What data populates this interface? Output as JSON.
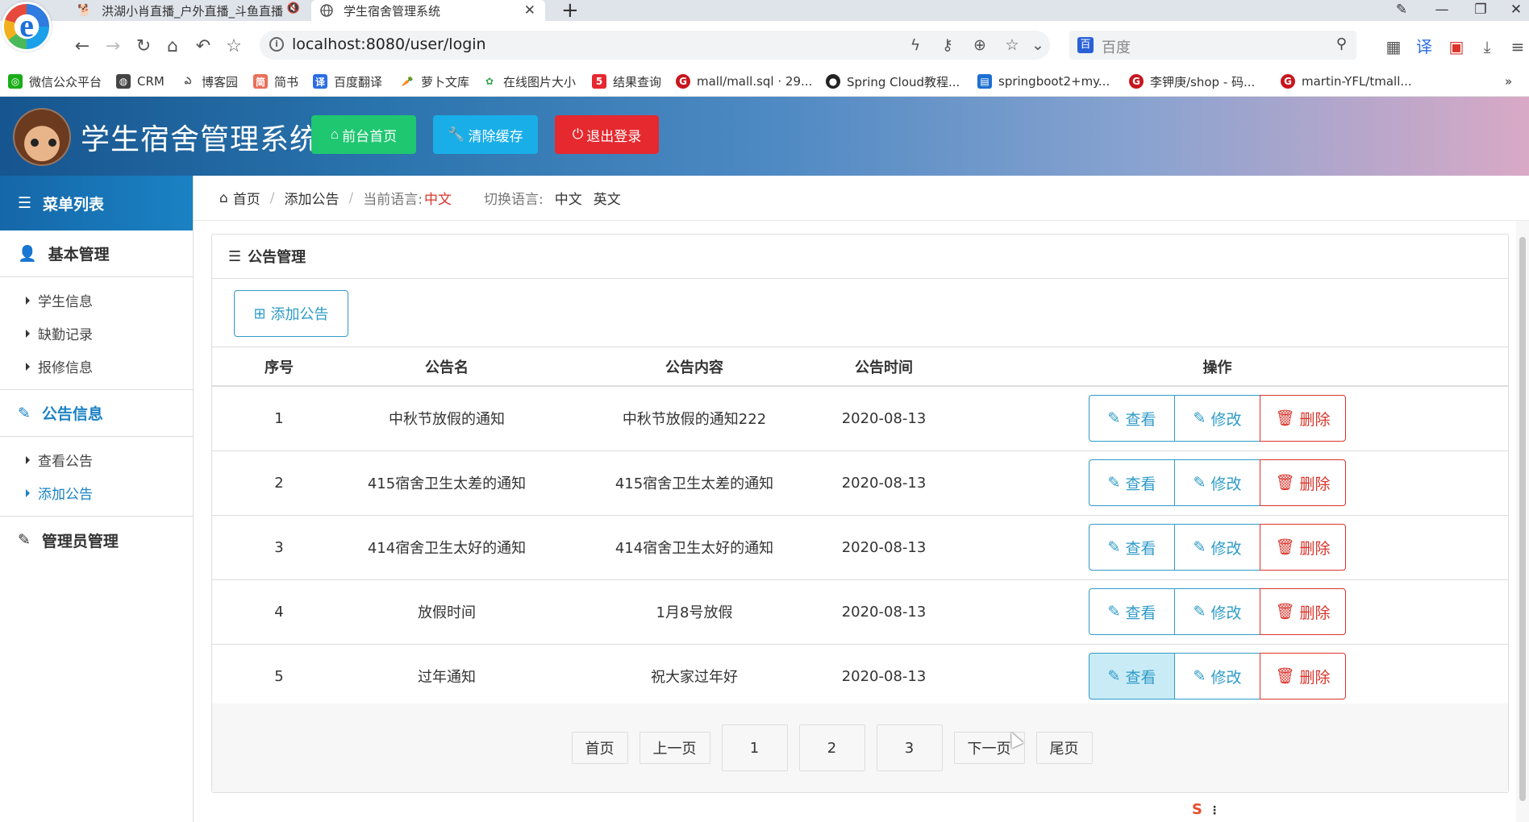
{
  "browser": {
    "tabs": [
      {
        "title": "洪湖小肖直播_户外直播_斗鱼直播",
        "icon": "doge-icon"
      },
      {
        "title": "学生宿舍管理系统",
        "icon": "globe-icon"
      }
    ],
    "url": "localhost:8080/user/login",
    "search_placeholder": "百度",
    "bookmarks": [
      {
        "label": "微信公众平台",
        "color": "#1aad19"
      },
      {
        "label": "CRM",
        "color": "#444444"
      },
      {
        "label": "博客园",
        "color": "#555555"
      },
      {
        "label": "简书",
        "color": "#ea6f5a"
      },
      {
        "label": "百度翻译",
        "color": "#2b6de5"
      },
      {
        "label": "萝卜文库",
        "color": "#e87b22"
      },
      {
        "label": "在线图片大小",
        "color": "#3aa652"
      },
      {
        "label": "结果查询",
        "color": "#e5292f"
      },
      {
        "label": "mall/mall.sql · 29...",
        "color": "#c7161e"
      },
      {
        "label": "Spring Cloud教程...",
        "color": "#222222"
      },
      {
        "label": "springboot2+my...",
        "color": "#1d6fd1"
      },
      {
        "label": "李钾庚/shop - 码...",
        "color": "#c7161e"
      },
      {
        "label": "martin-YFL/tmall...",
        "color": "#c7161e"
      }
    ]
  },
  "app": {
    "title": "学生宿舍管理系统",
    "header_buttons": {
      "home": "前台首页",
      "clear_cache": "清除缓存",
      "logout": "退出登录"
    },
    "colors": {
      "green": "#1fc770",
      "cyan": "#19aee8",
      "red": "#e5292f",
      "primary": "#1a82c4"
    }
  },
  "sidebar": {
    "title": "菜单列表",
    "groups": [
      {
        "label": "基本管理",
        "items": [
          "学生信息",
          "缺勤记录",
          "报修信息"
        ]
      },
      {
        "label": "公告信息",
        "items": [
          "查看公告",
          "添加公告"
        ]
      },
      {
        "label": "管理员管理",
        "items": []
      }
    ]
  },
  "breadcrumb": {
    "home": "首页",
    "current": "添加公告",
    "lang_label": "当前语言:",
    "lang_value": "中文",
    "switch_label": "切换语言:",
    "lang_zh": "中文",
    "lang_en": "英文"
  },
  "panel": {
    "title": "公告管理",
    "add_button": "添加公告",
    "columns": [
      "序号",
      "公告名",
      "公告内容",
      "公告时间",
      "操作"
    ],
    "rows": [
      {
        "id": "1",
        "name": "中秋节放假的通知",
        "content": "中秋节放假的通知222",
        "time": "2020-08-13"
      },
      {
        "id": "2",
        "name": "415宿舍卫生太差的通知",
        "content": "415宿舍卫生太差的通知",
        "time": "2020-08-13"
      },
      {
        "id": "3",
        "name": "414宿舍卫生太好的通知",
        "content": "414宿舍卫生太好的通知",
        "time": "2020-08-13"
      },
      {
        "id": "4",
        "name": "放假时间",
        "content": "1月8号放假",
        "time": "2020-08-13"
      },
      {
        "id": "5",
        "name": "过年通知",
        "content": "祝大家过年好",
        "time": "2020-08-13"
      }
    ],
    "actions": {
      "view": "查看",
      "edit": "修改",
      "delete": "删除"
    }
  },
  "pagination": {
    "first": "首页",
    "prev": "上一页",
    "pages": [
      "1",
      "2",
      "3"
    ],
    "next": "下一页",
    "last": "尾页"
  }
}
